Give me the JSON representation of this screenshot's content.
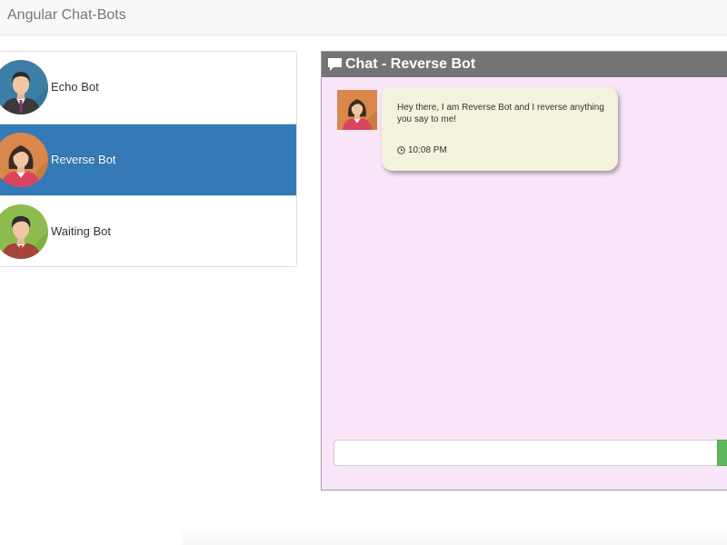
{
  "navbar": {
    "brand": "Angular Chat-Bots"
  },
  "bots": [
    {
      "name": "Echo Bot",
      "active": false
    },
    {
      "name": "Reverse Bot",
      "active": true
    },
    {
      "name": "Waiting Bot",
      "active": false
    }
  ],
  "chat": {
    "title": "Chat - Reverse Bot",
    "messages": [
      {
        "text": "Hey there, I am Reverse Bot and I reverse anything you say to me!",
        "time": "10:08 PM"
      }
    ],
    "input_value": "",
    "input_placeholder": ""
  },
  "colors": {
    "active_item": "#337ab7",
    "chat_bg": "#f8e6f8",
    "header_bg": "#747474",
    "bubble_bg": "#f4f2dd",
    "send_button": "#5cb85c"
  },
  "icons": [
    "comment-icon",
    "clock-icon",
    "avatar-echo",
    "avatar-reverse",
    "avatar-waiting"
  ]
}
